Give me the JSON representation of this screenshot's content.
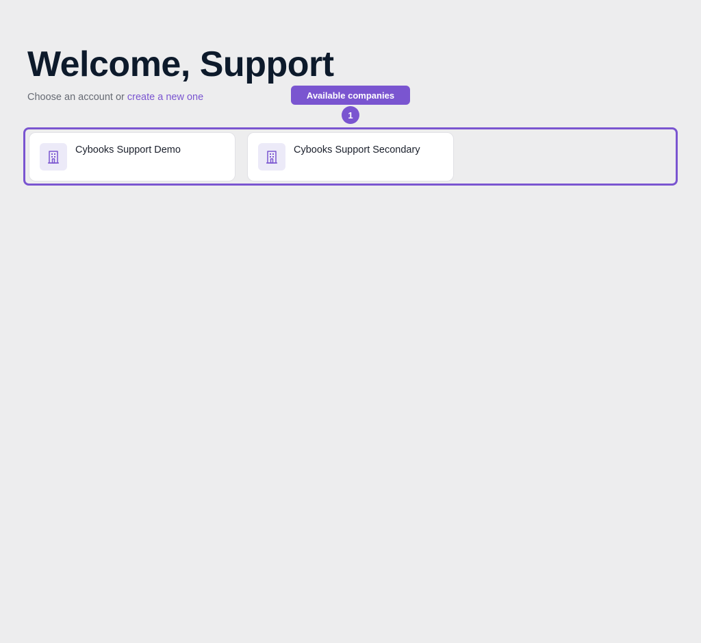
{
  "header": {
    "title": "Welcome, Support",
    "subtitle_prefix": "Choose an account or ",
    "create_link": "create a new one"
  },
  "callout": {
    "label": "Available companies",
    "number": "1"
  },
  "companies": [
    {
      "name": "Cybooks Support Demo",
      "icon": "building-icon"
    },
    {
      "name": "Cybooks Support Secondary",
      "icon": "building-icon"
    }
  ],
  "colors": {
    "accent": "#7a55d0",
    "background": "#ededee",
    "title": "#0d1a2b",
    "icon_bg": "#eceaf8"
  }
}
